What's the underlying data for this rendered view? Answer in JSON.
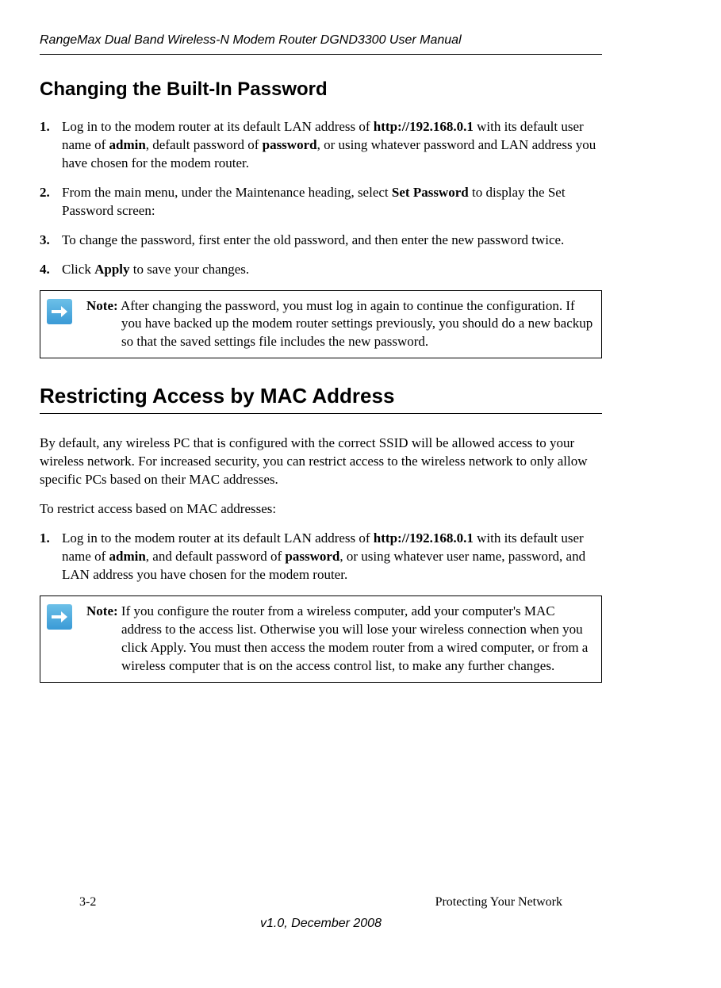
{
  "header": {
    "title": "RangeMax Dual Band Wireless-N Modem Router DGND3300 User Manual"
  },
  "section1": {
    "heading": "Changing the Built-In Password",
    "step1_pre": "Log in to the modem router at its default LAN address of ",
    "step1_url": "http://192.168.0.1",
    "step1_mid1": " with its default user name of ",
    "step1_admin": "admin",
    "step1_mid2": ", default password of ",
    "step1_password": "password",
    "step1_post": ", or using whatever password and LAN address you have chosen for the modem router.",
    "step2_pre": "From the main menu, under the Maintenance heading, select ",
    "step2_bold": "Set Password",
    "step2_post": " to display the Set Password screen:",
    "step3": "To change the password, first enter the old password, and then enter the new password twice.",
    "step4_pre": "Click ",
    "step4_bold": "Apply",
    "step4_post": " to save your changes.",
    "note_label": "Note:",
    "note_text": " After changing the password, you must log in again to continue the configuration. If you have backed up the modem router settings previously, you should do a new backup so that the saved settings file includes the new password."
  },
  "section2": {
    "heading": "Restricting Access by MAC Address",
    "para1": "By default, any wireless PC that is configured with the correct SSID will be allowed access to your wireless network. For increased security, you can restrict access to the wireless network to only allow specific PCs based on their MAC addresses.",
    "para2": "To restrict access based on MAC addresses:",
    "step1_pre": "Log in to the modem router at its default LAN address of ",
    "step1_url": "http://192.168.0.1",
    "step1_mid1": " with its default user name of ",
    "step1_admin": "admin",
    "step1_mid2": ", and default password of ",
    "step1_password": "password",
    "step1_post": ", or using whatever user name, password, and LAN address you have chosen for the modem router.",
    "note_label": "Note:",
    "note_text": " If you configure the router from a wireless computer, add your computer's MAC address to the access list. Otherwise you will lose your wireless connection when you click Apply. You must then access the modem router from a wired computer, or from a wireless computer that is on the access control list, to make any further changes."
  },
  "footer": {
    "page": "3-2",
    "chapter": "Protecting Your Network",
    "version": "v1.0, December 2008"
  }
}
